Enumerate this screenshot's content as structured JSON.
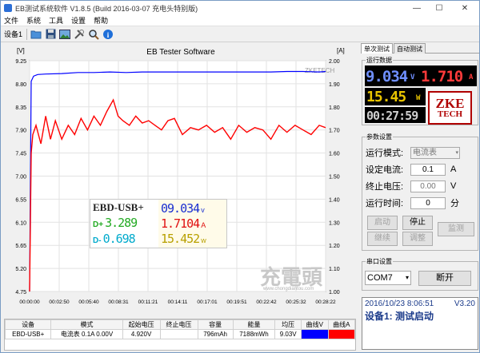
{
  "window": {
    "title": "EB测试系统软件 V1.8.5 (Build 2016-03-07 充电头特别版)",
    "min": "—",
    "max": "☐",
    "close": "✕"
  },
  "menu": [
    "文件",
    "系统",
    "工具",
    "设置",
    "帮助"
  ],
  "toolbar": {
    "device_label": "设备1",
    "icons": [
      "folder-icon",
      "save-icon",
      "image-icon",
      "tools-icon",
      "search-icon",
      "info-icon"
    ]
  },
  "chart": {
    "title": "EB Tester Software",
    "left_unit": "[V]",
    "right_unit": "[A]",
    "watermark": "ZKETECH",
    "site_watermark_main": "充電頭",
    "site_watermark_sub": "www.chongdiantou.com"
  },
  "chart_data": {
    "type": "line",
    "title": "EB Tester Software",
    "ylabel": "[V]",
    "y2label": "[A]",
    "ylim": [
      4.75,
      9.25
    ],
    "y2lim": [
      1.0,
      2.0
    ],
    "yticks": [
      "9.25",
      "8.80",
      "8.35",
      "7.90",
      "7.45",
      "7.00",
      "6.55",
      "6.10",
      "5.65",
      "5.20",
      "4.75"
    ],
    "y2ticks": [
      "2.00",
      "1.90",
      "1.80",
      "1.70",
      "1.60",
      "1.50",
      "1.40",
      "1.30",
      "1.20",
      "1.10",
      "1.00"
    ],
    "xticks": [
      "00:00:00",
      "00:02:50",
      "00:05:40",
      "00:08:31",
      "00:11:21",
      "00:14:11",
      "00:17:01",
      "00:19:51",
      "00:22:42",
      "00:25:32",
      "00:28:22"
    ],
    "grid": true,
    "series": [
      {
        "name": "曲线V",
        "axis": "left",
        "color": "#0000ff",
        "x": [
          0,
          2,
          5,
          10,
          20,
          40,
          60,
          80,
          100,
          120,
          140,
          160,
          180,
          200,
          220,
          240,
          260,
          280,
          300,
          320,
          340,
          360,
          368
        ],
        "values": [
          4.75,
          8.85,
          8.95,
          8.98,
          8.99,
          9.0,
          9.02,
          9.02,
          9.03,
          9.02,
          9.03,
          9.03,
          9.03,
          9.03,
          9.03,
          9.03,
          9.03,
          9.03,
          9.03,
          9.04,
          9.04,
          9.03,
          9.04
        ]
      },
      {
        "name": "曲线A",
        "axis": "right",
        "color": "#ff0000",
        "x": [
          0,
          2,
          4,
          8,
          14,
          20,
          26,
          32,
          40,
          48,
          56,
          64,
          72,
          80,
          88,
          96,
          104,
          110,
          116,
          124,
          132,
          140,
          148,
          156,
          164,
          172,
          180,
          190,
          200,
          210,
          220,
          230,
          240,
          250,
          260,
          270,
          280,
          290,
          300,
          310,
          320,
          330,
          340,
          350,
          360,
          368
        ],
        "values": [
          1.0,
          1.6,
          1.68,
          1.72,
          1.64,
          1.76,
          1.66,
          1.74,
          1.66,
          1.72,
          1.68,
          1.75,
          1.7,
          1.76,
          1.72,
          1.78,
          1.83,
          1.76,
          1.74,
          1.72,
          1.76,
          1.73,
          1.74,
          1.72,
          1.7,
          1.74,
          1.75,
          1.68,
          1.71,
          1.7,
          1.72,
          1.69,
          1.71,
          1.66,
          1.72,
          1.69,
          1.71,
          1.7,
          1.66,
          1.72,
          1.69,
          1.72,
          1.7,
          1.68,
          1.72,
          1.71
        ]
      }
    ]
  },
  "meter": {
    "model": "EBD-USB+",
    "voltage": "09.034",
    "voltage_unit": "v",
    "dplus_label": "D+",
    "dplus": "3.289",
    "current": "1.7104",
    "current_unit": "A",
    "dminus_label": "D-",
    "dminus": "0.698",
    "power": "15.452",
    "power_unit": "w"
  },
  "stats": {
    "headers": [
      "设备",
      "模式",
      "起始电压",
      "终止电压",
      "容量",
      "能量",
      "均压",
      "曲线V",
      "曲线A"
    ],
    "row": [
      "EBD-USB+",
      "电流表 0.1A 0.00V",
      "4.920V",
      "",
      "796mAh",
      "7188mWh",
      "9.03V",
      "",
      ""
    ]
  },
  "tabs": [
    "单次测试",
    "自动测试"
  ],
  "running": {
    "title": "运行数据",
    "voltage": "9.034",
    "voltage_unit": "V",
    "current": "1.710",
    "current_unit": "A",
    "power": "15.45",
    "power_unit": "W",
    "time": "00:27:59",
    "logo_top": "ZKE",
    "logo_bottom": "TECH"
  },
  "params": {
    "title": "参数设置",
    "mode_label": "运行模式:",
    "mode_value": "电流表",
    "current_label": "设定电流:",
    "current_value": "0.1",
    "current_unit": "A",
    "cutoff_label": "终止电压:",
    "cutoff_value": "0.00",
    "cutoff_unit": "V",
    "time_label": "运行时间:",
    "time_value": "0",
    "time_unit": "分",
    "btn_start": "启动",
    "btn_stop": "停止",
    "btn_monitor": "监测",
    "btn_continue": "继续",
    "btn_adjust": "调整"
  },
  "serial": {
    "title": "串口设置",
    "port": "COM7",
    "btn_disconnect": "断开"
  },
  "status": {
    "datetime": "2016/10/23 8:06:51",
    "version": "V3.20",
    "device_status": "设备1: 测试启动"
  }
}
